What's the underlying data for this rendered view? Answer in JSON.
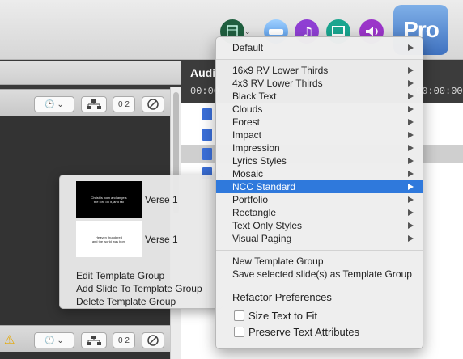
{
  "audio_panel": {
    "title": "Audi",
    "time_left": "00:00",
    "time_right": "00:00:00"
  },
  "app_logo": "Pro",
  "toolbar_icons": [
    "network-icon",
    "drive-icon",
    "music-icon",
    "screen-icon",
    "speaker-icon"
  ],
  "template_popup": {
    "slides": [
      {
        "thumb_text": "Christ is born and angels\nthe lord on it, and tail",
        "label": "Verse 1",
        "theme": "dark"
      },
      {
        "thumb_text": "Heaven thundered\nand the world was born",
        "label": "Verse 1",
        "theme": "light"
      }
    ],
    "actions": [
      "Edit Template Group",
      "Add Slide To Template Group",
      "Delete Template Group"
    ]
  },
  "menu": {
    "default_item": "Default",
    "items": [
      "16x9 RV Lower Thirds",
      "4x3 RV Lower Thirds",
      "Black Text",
      "Clouds",
      "Forest",
      "Impact",
      "Impression",
      "Lyrics Styles",
      "Mosaic",
      "NCC Standard",
      "Portfolio",
      "Rectangle",
      "Text Only Styles",
      "Visual Paging"
    ],
    "selected_item": "NCC Standard",
    "new_group": "New Template Group",
    "save_selected": "Save selected slide(s) as Template Group",
    "refactor_header": "Refactor Preferences",
    "size_text": "Size Text to Fit",
    "preserve_text": "Preserve Text Attributes"
  },
  "colors": {
    "highlight": "#2f79dc",
    "file_icon": "#3b6fd8"
  }
}
